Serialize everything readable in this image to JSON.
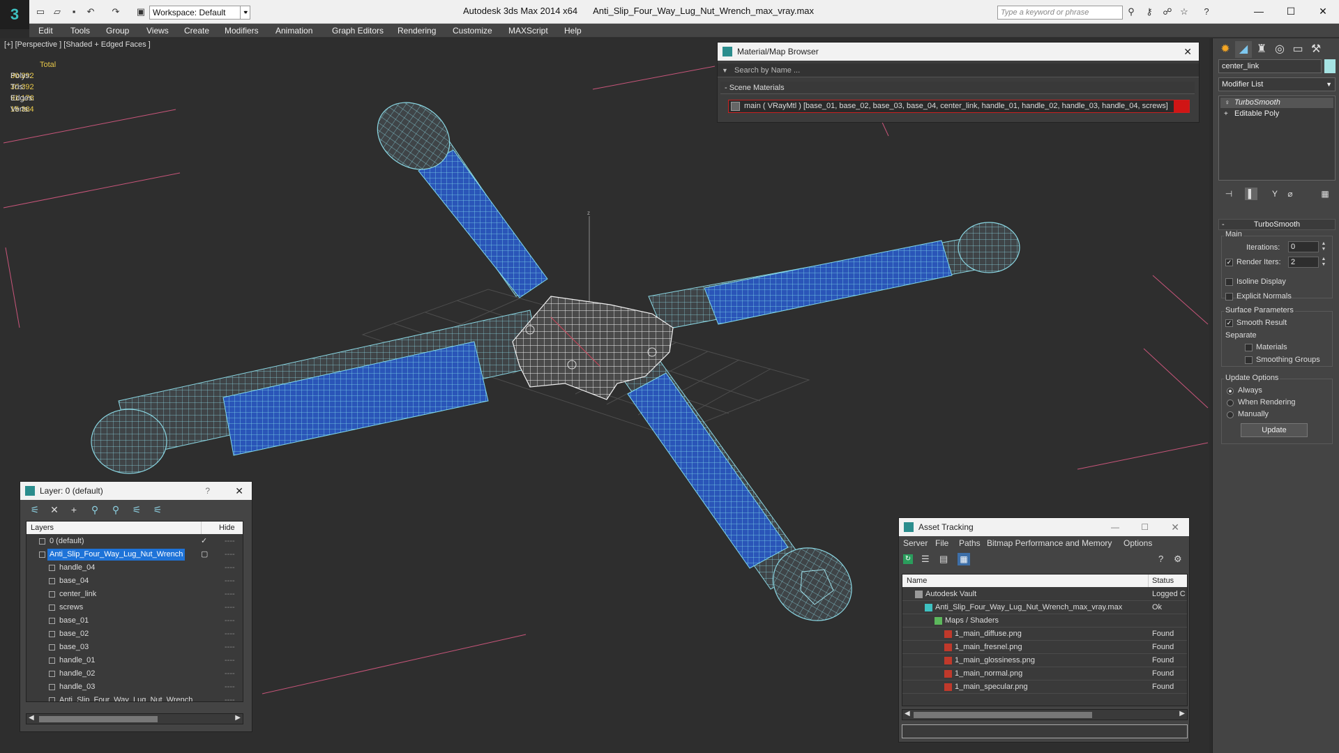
{
  "titlebar": {
    "app": "Autodesk 3ds Max  2014 x64",
    "file": "Anti_Slip_Four_Way_Lug_Nut_Wrench_max_vray.max",
    "workspace": "Workspace: Default",
    "search_placeholder": "Type a keyword or phrase",
    "logo": "3"
  },
  "menu": [
    "Edit",
    "Tools",
    "Group",
    "Views",
    "Create",
    "Modifiers",
    "Animation",
    "Graph Editors",
    "Rendering",
    "Customize",
    "MAXScript",
    "Help"
  ],
  "viewport": {
    "label": "[+] [Perspective ] [Shaded + Edged Faces ]",
    "stats": {
      "header": "Total",
      "rows": [
        {
          "label": "Polys:",
          "value": "30 392"
        },
        {
          "label": "Tris:",
          "value": "30 392"
        },
        {
          "label": "Edges:",
          "value": "91 176"
        },
        {
          "label": "Verts:",
          "value": "15 364"
        }
      ]
    },
    "axis_label": "z"
  },
  "material_browser": {
    "title": "Material/Map Browser",
    "search_placeholder": "Search by Name ...",
    "section": "- Scene Materials",
    "entry": "main  ( VRayMtl )  [base_01, base_02, base_03, base_04, center_link, handle_01, handle_02, handle_03, handle_04, screws]"
  },
  "command_panel": {
    "object_name": "center_link",
    "object_color": "#a6e3e3",
    "modifier_list": "Modifier List",
    "stack": [
      "TurboSmooth",
      "Editable Poly"
    ],
    "rollout": "TurboSmooth",
    "main_label": "Main",
    "iterations_label": "Iterations:",
    "iterations_value": "0",
    "render_iters_label": "Render Iters:",
    "render_iters_value": "2",
    "isoline": "Isoline Display",
    "explicit_normals": "Explicit Normals",
    "surface_params": "Surface Parameters",
    "smooth_result": "Smooth Result",
    "separate": "Separate",
    "materials": "Materials",
    "smoothing_groups": "Smoothing Groups",
    "update_options": "Update Options",
    "always": "Always",
    "when_rendering": "When Rendering",
    "manually": "Manually",
    "update_btn": "Update"
  },
  "layer_explorer": {
    "title": "Layer: 0 (default)",
    "help": "?",
    "col_layers": "Layers",
    "col_hide": "Hide",
    "rows": [
      {
        "name": "0 (default)",
        "indent": 1,
        "type": "layer",
        "check": "✓"
      },
      {
        "name": "Anti_Slip_Four_Way_Lug_Nut_Wrench",
        "indent": 1,
        "type": "layer",
        "selected": true,
        "check": "▢"
      },
      {
        "name": "handle_04",
        "indent": 2,
        "type": "obj"
      },
      {
        "name": "base_04",
        "indent": 2,
        "type": "obj"
      },
      {
        "name": "center_link",
        "indent": 2,
        "type": "obj"
      },
      {
        "name": "screws",
        "indent": 2,
        "type": "obj"
      },
      {
        "name": "base_01",
        "indent": 2,
        "type": "obj"
      },
      {
        "name": "base_02",
        "indent": 2,
        "type": "obj"
      },
      {
        "name": "base_03",
        "indent": 2,
        "type": "obj"
      },
      {
        "name": "handle_01",
        "indent": 2,
        "type": "obj"
      },
      {
        "name": "handle_02",
        "indent": 2,
        "type": "obj"
      },
      {
        "name": "handle_03",
        "indent": 2,
        "type": "obj"
      },
      {
        "name": "Anti_Slip_Four_Way_Lug_Nut_Wrench",
        "indent": 2,
        "type": "obj"
      }
    ],
    "hide_mark": "----"
  },
  "asset_tracking": {
    "title": "Asset Tracking",
    "menu": [
      "Server",
      "File",
      "Paths",
      "Bitmap Performance and Memory",
      "Options"
    ],
    "col_name": "Name",
    "col_status": "Status",
    "rows": [
      {
        "name": "Autodesk Vault",
        "indent": 1,
        "status": "Logged C",
        "icon": "vault"
      },
      {
        "name": "Anti_Slip_Four_Way_Lug_Nut_Wrench_max_vray.max",
        "indent": 2,
        "status": "Ok",
        "icon": "max"
      },
      {
        "name": "Maps / Shaders",
        "indent": 3,
        "status": "",
        "icon": "maps"
      },
      {
        "name": "1_main_diffuse.png",
        "indent": 4,
        "status": "Found",
        "icon": "png"
      },
      {
        "name": "1_main_fresnel.png",
        "indent": 4,
        "status": "Found",
        "icon": "png"
      },
      {
        "name": "1_main_glossiness.png",
        "indent": 4,
        "status": "Found",
        "icon": "png"
      },
      {
        "name": "1_main_normal.png",
        "indent": 4,
        "status": "Found",
        "icon": "png"
      },
      {
        "name": "1_main_specular.png",
        "indent": 4,
        "status": "Found",
        "icon": "png"
      }
    ]
  }
}
